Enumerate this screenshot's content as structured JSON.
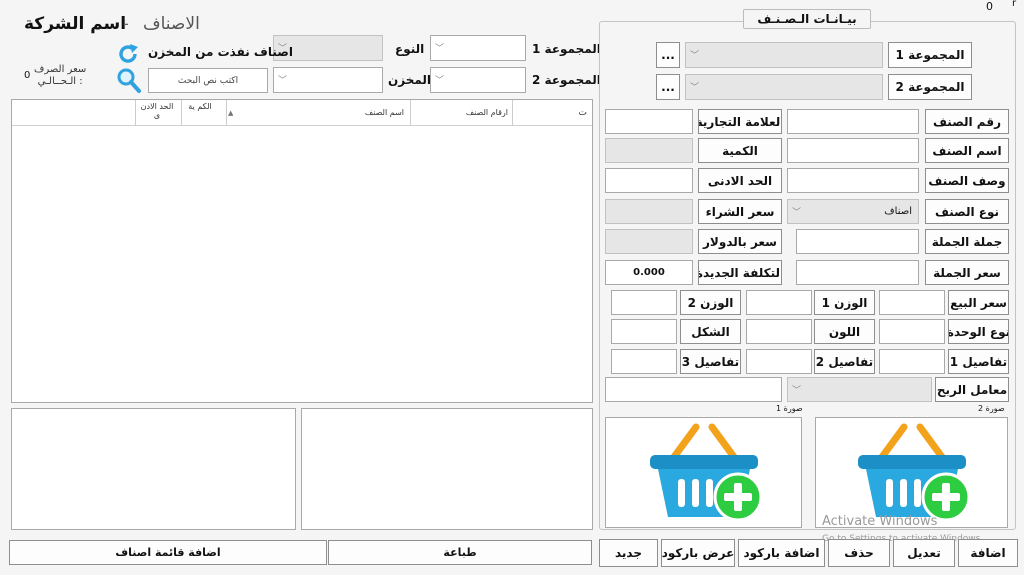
{
  "window": {
    "right_indicator": "0",
    "top_right_glyph": "r"
  },
  "header": {
    "company": "اسم الشركة",
    "separator": "-",
    "title": "الاصناف"
  },
  "exchange_rate": {
    "line1": "سعر الصرف",
    "line2": "الـحــالـي :",
    "value": "0"
  },
  "filters": {
    "group1_label": "المجموعة 1",
    "group2_label": "المجموعة 2",
    "type_label": "النوع",
    "store_label": "المخزن",
    "out_of_stock_label": "اصناف نفذت من المخزن",
    "search_placeholder": "اكتب نص البحث"
  },
  "table": {
    "columns": [
      "ت",
      "ارقام الصنف",
      "اسم الصنف",
      "الكم ية",
      "الحد الادن ى"
    ],
    "sort_glyph": "▲",
    "rows": []
  },
  "item_panel": {
    "title": "بيـانـات الـصـنـف",
    "group1_button": "المجموعة 1",
    "group2_button": "المجموعة 2",
    "more_button": "...",
    "labels": {
      "item_number": "رقم الصنف",
      "brand": "العلامة التجارية",
      "item_name": "اسم الصنف",
      "quantity": "الكمية",
      "description": "وصف الصنف",
      "min_limit": "الحد الادنى",
      "item_type": "نوع الصنف",
      "purchase_price": "سعر الشراء",
      "wholesale_qty": "جملة الجملة",
      "usd_price": "سعر بالدولار",
      "wholesale_price": "سعر الجملة",
      "new_cost": "التكلفة الجديدة",
      "sale_price": "سعر البيع",
      "weight1": "الوزن 1",
      "weight2": "الوزن 2",
      "unit_type": "نوع الوحدة",
      "color": "اللون",
      "shape": "الشكل",
      "details1": "تفاصيل 1",
      "details2": "تفاصيل 2",
      "details3": "تفاصيل 3",
      "profit_factor": "معامل الربح",
      "image1": "صورة 1",
      "image2": "صورة 2"
    },
    "values": {
      "item_type": "اصناف",
      "new_cost": "0.000"
    }
  },
  "watermark": {
    "line1": "Activate Windows",
    "line2": "Go to Settings to activate Windows."
  },
  "actions": {
    "add": "اضافة",
    "edit": "تعديل",
    "delete": "حذف",
    "add_barcode": "اضافة باركود",
    "show_barcode": "عرض باركود",
    "new": "جديد",
    "print": "طباعة",
    "add_item_list": "اضافة قائمة اصناف"
  },
  "colors": {
    "basket_blue": "#2aa8e0",
    "basket_handle": "#f3a31b",
    "plus_green": "#2ecc40"
  }
}
